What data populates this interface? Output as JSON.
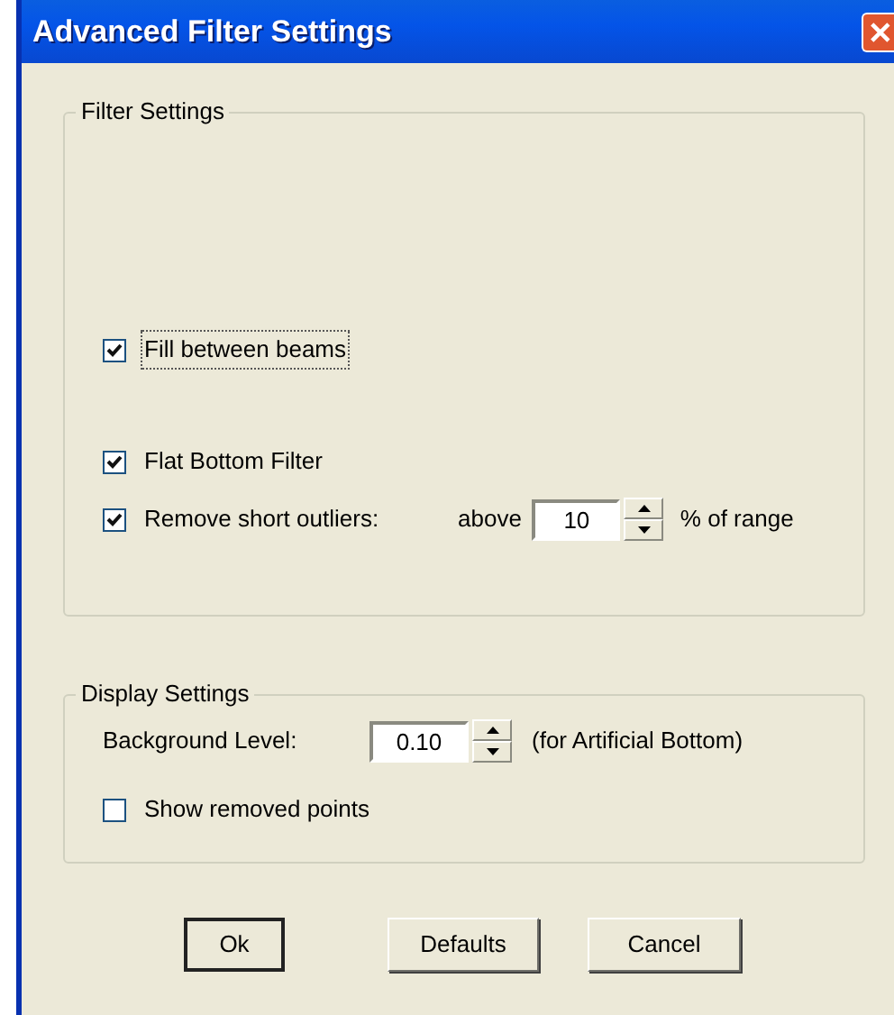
{
  "window": {
    "title": "Advanced Filter Settings"
  },
  "filter_settings": {
    "title": "Filter Settings",
    "options": [
      {
        "kind": "checkbox",
        "label": "Fill between beams",
        "checked": true,
        "focused": true
      },
      {
        "kind": "checkbox",
        "label": "Flat Bottom Filter",
        "checked": true,
        "focused": false
      },
      {
        "kind": "checkbox_spin",
        "label": "Remove short outliers:",
        "checked": true,
        "focused": false,
        "prefix": "above",
        "value": "10",
        "suffix": "% of range"
      }
    ]
  },
  "display_settings": {
    "title": "Display Settings",
    "options": [
      {
        "kind": "spin",
        "label": "Background Level:",
        "value": "0.10",
        "suffix": "(for Artificial Bottom)"
      },
      {
        "kind": "checkbox",
        "label": "Show removed points",
        "checked": false,
        "focused": false
      }
    ]
  },
  "buttons": [
    {
      "label": "Ok",
      "default": true
    },
    {
      "label": "Defaults",
      "default": false
    },
    {
      "label": "Cancel",
      "default": false
    }
  ]
}
